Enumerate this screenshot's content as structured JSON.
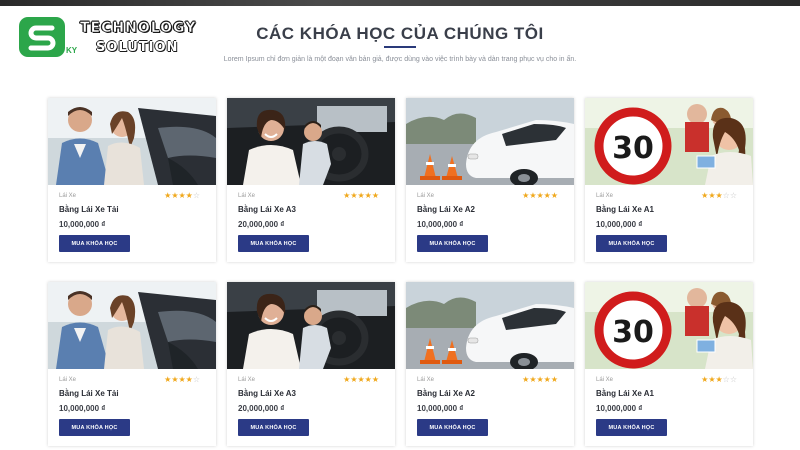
{
  "logo": {
    "line1": "TECHNOLOGY",
    "line2": "SOLUTION",
    "small": "KY"
  },
  "section": {
    "title": "CÁC KHÓA HỌC CỦA CHÚNG TÔI",
    "subtitle": "Lorem Ipsum chỉ đơn giản là một đoạn văn bản giả, được dùng vào việc trình bày và dàn trang phục vụ cho in ấn."
  },
  "colors": {
    "accent": "#2b3a86",
    "star": "#f0a81c",
    "logo_green": "#2ca64a"
  },
  "courses": [
    {
      "category": "Lái Xe",
      "name": "Bằng Lái Xe Tải",
      "price": "10,000,000 ₫",
      "rating": 4,
      "button": "MUA KHÓA HỌC",
      "image": "man-woman-car"
    },
    {
      "category": "Lái Xe",
      "name": "Bằng Lái Xe A3",
      "price": "20,000,000 ₫",
      "rating": 5,
      "button": "MUA KHÓA HỌC",
      "image": "woman-steering-wheel"
    },
    {
      "category": "Lái Xe",
      "name": "Bằng Lái Xe A2",
      "price": "10,000,000 ₫",
      "rating": 5,
      "button": "MUA KHÓA HỌC",
      "image": "white-car-cones"
    },
    {
      "category": "Lái Xe",
      "name": "Bằng Lái Xe A1",
      "price": "10,000,000 ₫",
      "rating": 3,
      "button": "MUA KHÓA HỌC",
      "image": "speed-sign-people"
    },
    {
      "category": "Lái Xe",
      "name": "Bằng Lái Xe Tải",
      "price": "10,000,000 ₫",
      "rating": 4,
      "button": "MUA KHÓA HỌC",
      "image": "man-woman-car"
    },
    {
      "category": "Lái Xe",
      "name": "Bằng Lái Xe A3",
      "price": "20,000,000 ₫",
      "rating": 5,
      "button": "MUA KHÓA HỌC",
      "image": "woman-steering-wheel"
    },
    {
      "category": "Lái Xe",
      "name": "Bằng Lái Xe A2",
      "price": "10,000,000 ₫",
      "rating": 5,
      "button": "MUA KHÓA HỌC",
      "image": "white-car-cones"
    },
    {
      "category": "Lái Xe",
      "name": "Bằng Lái Xe A1",
      "price": "10,000,000 ₫",
      "rating": 3,
      "button": "MUA KHÓA HỌC",
      "image": "speed-sign-people"
    }
  ],
  "speed_sign_text": "30"
}
